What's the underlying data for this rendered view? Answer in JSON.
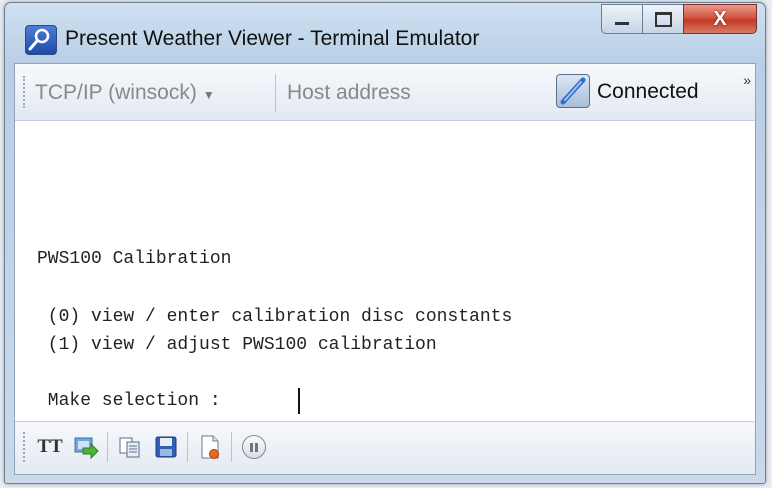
{
  "window": {
    "title": "Present Weather Viewer - Terminal Emulator",
    "controls": {
      "minimize_icon": "minimize-icon",
      "maximize_icon": "maximize-icon",
      "close_glyph": "X"
    }
  },
  "top_toolbar": {
    "connection_type": "TCP/IP (winsock)",
    "host": {
      "value": "",
      "placeholder": "Host address"
    },
    "connection_icon": "plug-connected-icon",
    "status": "Connected",
    "overflow_glyph": "»"
  },
  "terminal": {
    "lines": [
      "PWS100 Calibration",
      " (0) view / enter calibration disc constants",
      " (1) view / adjust PWS100 calibration",
      " Make selection : "
    ]
  },
  "bottom_toolbar": {
    "tt_label": "TT",
    "buttons": [
      "font-tt-icon",
      "send-file-icon",
      "copy-icon",
      "save-icon",
      "new-log-icon",
      "pause-icon"
    ]
  }
}
